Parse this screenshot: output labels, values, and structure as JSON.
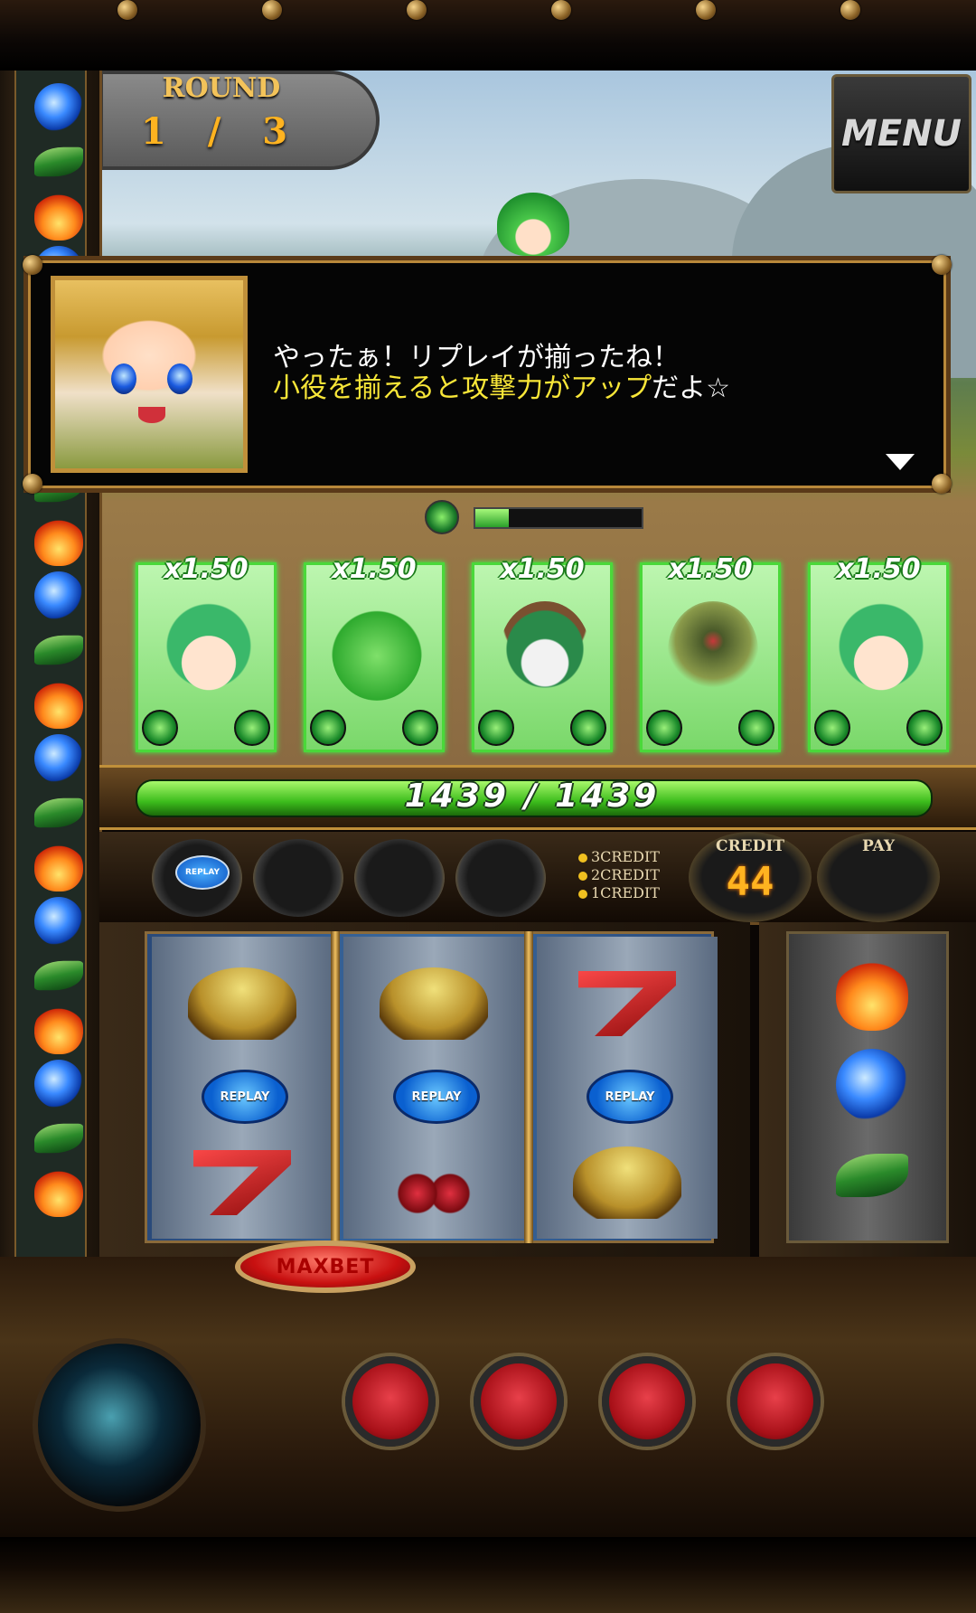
{
  "round": {
    "label": "ROUND",
    "value": "1 / 3"
  },
  "menu_button": "MENU",
  "dialog": {
    "line1": "やったぁ！リプレイが揃ったね！",
    "line2_highlight": "小役を揃えると攻撃力がアップ",
    "line2_rest": "だよ☆"
  },
  "party_gauge": {
    "fill_fraction": 0.2
  },
  "cards": [
    {
      "multiplier": "x1.50",
      "character": "green-hair-girl"
    },
    {
      "multiplier": "x1.50",
      "character": "green-slime"
    },
    {
      "multiplier": "x1.50",
      "character": "pilot-wolf"
    },
    {
      "multiplier": "x1.50",
      "character": "green-golem"
    },
    {
      "multiplier": "x1.50",
      "character": "green-hair-girl"
    }
  ],
  "hp": {
    "text": "1439 / 1439",
    "current": 1439,
    "max": 1439
  },
  "bet_slots": [
    {
      "filled": true,
      "label": "REPLAY"
    },
    {
      "filled": false
    },
    {
      "filled": false
    },
    {
      "filled": false
    }
  ],
  "bet_levels": [
    "3CREDIT",
    "2CREDIT",
    "1CREDIT"
  ],
  "credit": {
    "label": "CREDIT",
    "value": "44"
  },
  "pay": {
    "label": "PAY",
    "value": ""
  },
  "reels": [
    [
      "bell",
      "REPLAY",
      "seven"
    ],
    [
      "bell",
      "REPLAY",
      "cherry"
    ],
    [
      "seven",
      "REPLAY",
      "bell"
    ]
  ],
  "replay_symbol_label": "REPLAY",
  "side_reel": [
    "fire",
    "water",
    "leaf"
  ],
  "maxbet_label": "MAXBET",
  "left_rail_gems": [
    "water",
    "leaf",
    "fire",
    "water",
    "leaf",
    "fire",
    "water",
    "leaf",
    "fire",
    "water",
    "leaf",
    "fire",
    "water",
    "leaf",
    "fire",
    "water",
    "leaf",
    "fire",
    "water",
    "leaf",
    "fire"
  ],
  "colors": {
    "accent_green": "#3cbc1c",
    "gold": "#f3c35a",
    "credit_orange": "#ffb320",
    "highlight_yellow": "#f8e638"
  }
}
